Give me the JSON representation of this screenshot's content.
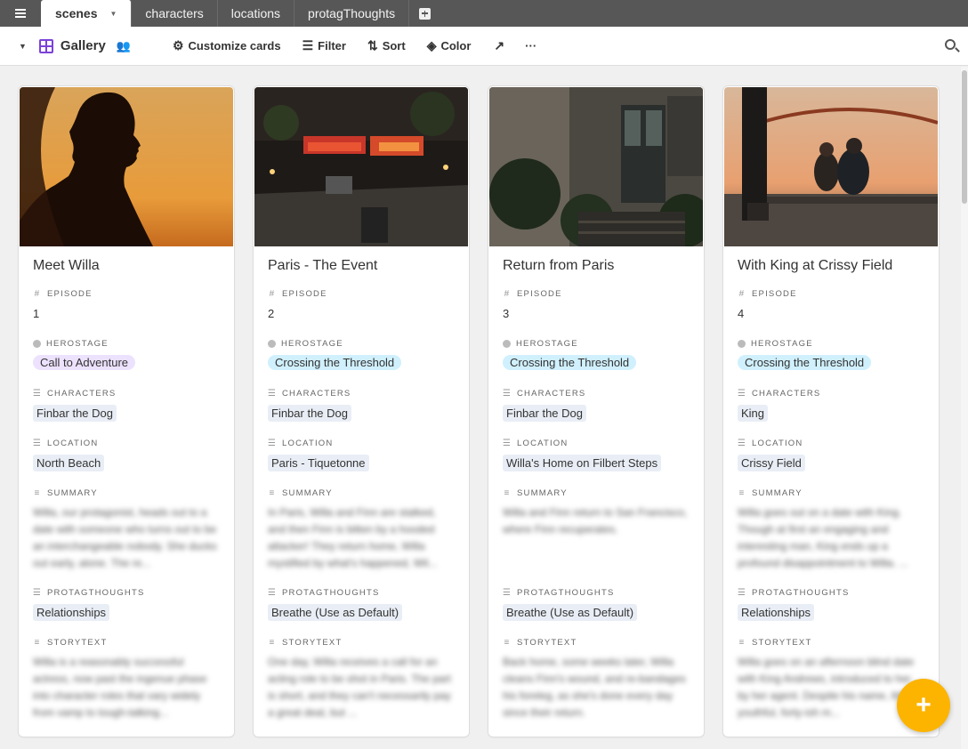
{
  "tabs": [
    {
      "label": "scenes",
      "active": true
    },
    {
      "label": "characters"
    },
    {
      "label": "locations"
    },
    {
      "label": "protagThoughts"
    }
  ],
  "toolbar": {
    "view_name": "Gallery",
    "customize_label": "Customize cards",
    "filter_label": "Filter",
    "sort_label": "Sort",
    "color_label": "Color",
    "more_label": "···"
  },
  "field_labels": {
    "episode": "EPISODE",
    "herostage": "HEROSTAGE",
    "characters": "CHARACTERS",
    "location": "LOCATION",
    "summary": "SUMMARY",
    "protagthoughts": "PROTAGTHOUGHTS",
    "storytext": "STORYTEXT"
  },
  "colors": {
    "accent": "#fcb400",
    "gallery_icon": "#7b42d9",
    "herostage_adventure": "#ede2fe",
    "herostage_threshold": "#d0f0fd"
  },
  "cards": [
    {
      "title": "Meet Willa",
      "episode": "1",
      "herostage": "Call to Adventure",
      "characters": "Finbar the Dog",
      "location": "North Beach",
      "summary": "Willa, our protagonist, heads out to a date with someone who turns out to be an interchangeable nobody. She ducks out early, alone. The re...",
      "protagthoughts": "Relationships",
      "storytext": "Willa is a reasonably successful actress, now past the ingenue phase into character roles that vary widely from vamp to tough-talking..."
    },
    {
      "title": "Paris - The Event",
      "episode": "2",
      "herostage": "Crossing the Threshold",
      "characters": "Finbar the Dog",
      "location": "Paris - Tiquetonne",
      "summary": "In Paris, Willa and Finn are stalked, and then Finn is bitten by a hooded attacker! They return home, Willa mystified by what's happened, Wil...",
      "protagthoughts": "Breathe (Use as Default)",
      "storytext": "One day, Willa receives a call for an acting role to be shot in Paris. The part is short, and they can't necessarily pay a great deal, but ..."
    },
    {
      "title": "Return from Paris",
      "episode": "3",
      "herostage": "Crossing the Threshold",
      "characters": "Finbar the Dog",
      "location": "Willa's Home on Filbert Steps",
      "summary": "Willa and Finn return to San Francisco, where Finn recuperates.",
      "protagthoughts": "Breathe (Use as Default)",
      "storytext": "Back home, some weeks later, Willa cleans Finn's wound, and re-bandages his foreleg, as she's done every day since their return."
    },
    {
      "title": "With King at Crissy Field",
      "episode": "4",
      "herostage": "Crossing the Threshold",
      "characters": "King",
      "location": "Crissy Field",
      "summary": "Willa goes out on a date with King. Though at first an engaging and interesting man, King ends up a profound disappointment to Willa. ...",
      "protagthoughts": "Relationships",
      "storytext": "Willa goes on an afternoon blind date with King Andrews, introduced to her by her agent. Despite his name, this youthful, forty-ish m..."
    }
  ]
}
